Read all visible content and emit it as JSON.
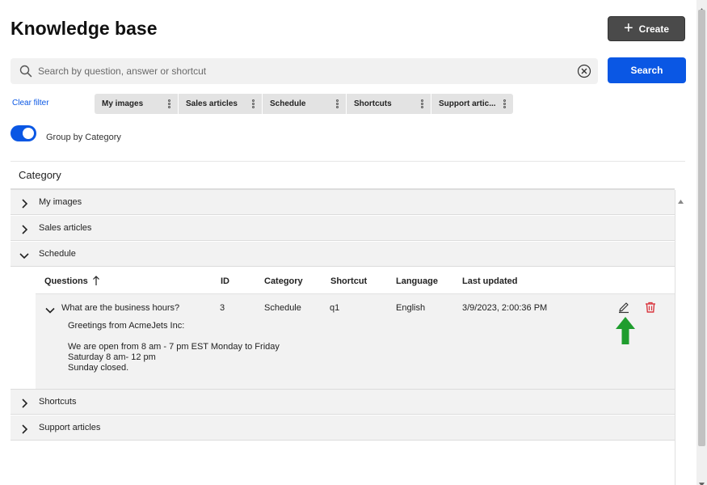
{
  "header": {
    "title": "Knowledge base",
    "create_label": "Create"
  },
  "search": {
    "placeholder": "Search by question, answer or shortcut",
    "value": "",
    "button_label": "Search"
  },
  "filters": {
    "clear_label": "Clear filter",
    "chips": [
      {
        "label": "My images"
      },
      {
        "label": "Sales articles"
      },
      {
        "label": "Schedule"
      },
      {
        "label": "Shortcuts"
      },
      {
        "label": "Support artic..."
      }
    ]
  },
  "group_toggle": {
    "label": "Group by Category",
    "on": true
  },
  "list": {
    "header": "Category",
    "groups": [
      {
        "label": "My images",
        "expanded": false
      },
      {
        "label": "Sales articles",
        "expanded": false
      },
      {
        "label": "Schedule",
        "expanded": true
      },
      {
        "label": "Shortcuts",
        "expanded": false
      },
      {
        "label": "Support articles",
        "expanded": false
      }
    ]
  },
  "table": {
    "columns": [
      "Questions",
      "ID",
      "Category",
      "Shortcut",
      "Language",
      "Last updated"
    ],
    "rows": [
      {
        "question": "What are the business hours?",
        "id": "3",
        "category": "Schedule",
        "shortcut": "q1",
        "language": "English",
        "updated": "3/9/2023, 2:00:36 PM",
        "answer": {
          "line1": "Greetings from AcmeJets Inc:",
          "line2": "We are open from 8 am - 7 pm EST Monday to Friday",
          "line3": "Saturday 8 am- 12 pm",
          "line4": "Sunday closed."
        }
      }
    ]
  },
  "colors": {
    "primary": "#0a57e4",
    "create_bg": "#4a4a4a",
    "delete": "#d9363e",
    "arrow": "#1f9d2e"
  },
  "icons": {
    "search": "search-icon",
    "clear": "clear-circle-x-icon",
    "plus": "plus-icon",
    "kebab": "kebab-menu-icon",
    "chevron_right": "chevron-right-icon",
    "chevron_down": "chevron-down-icon",
    "sort": "sort-arrow-up-icon",
    "edit": "pencil-icon",
    "delete": "trash-icon",
    "pointer": "green-arrow-up-icon"
  }
}
